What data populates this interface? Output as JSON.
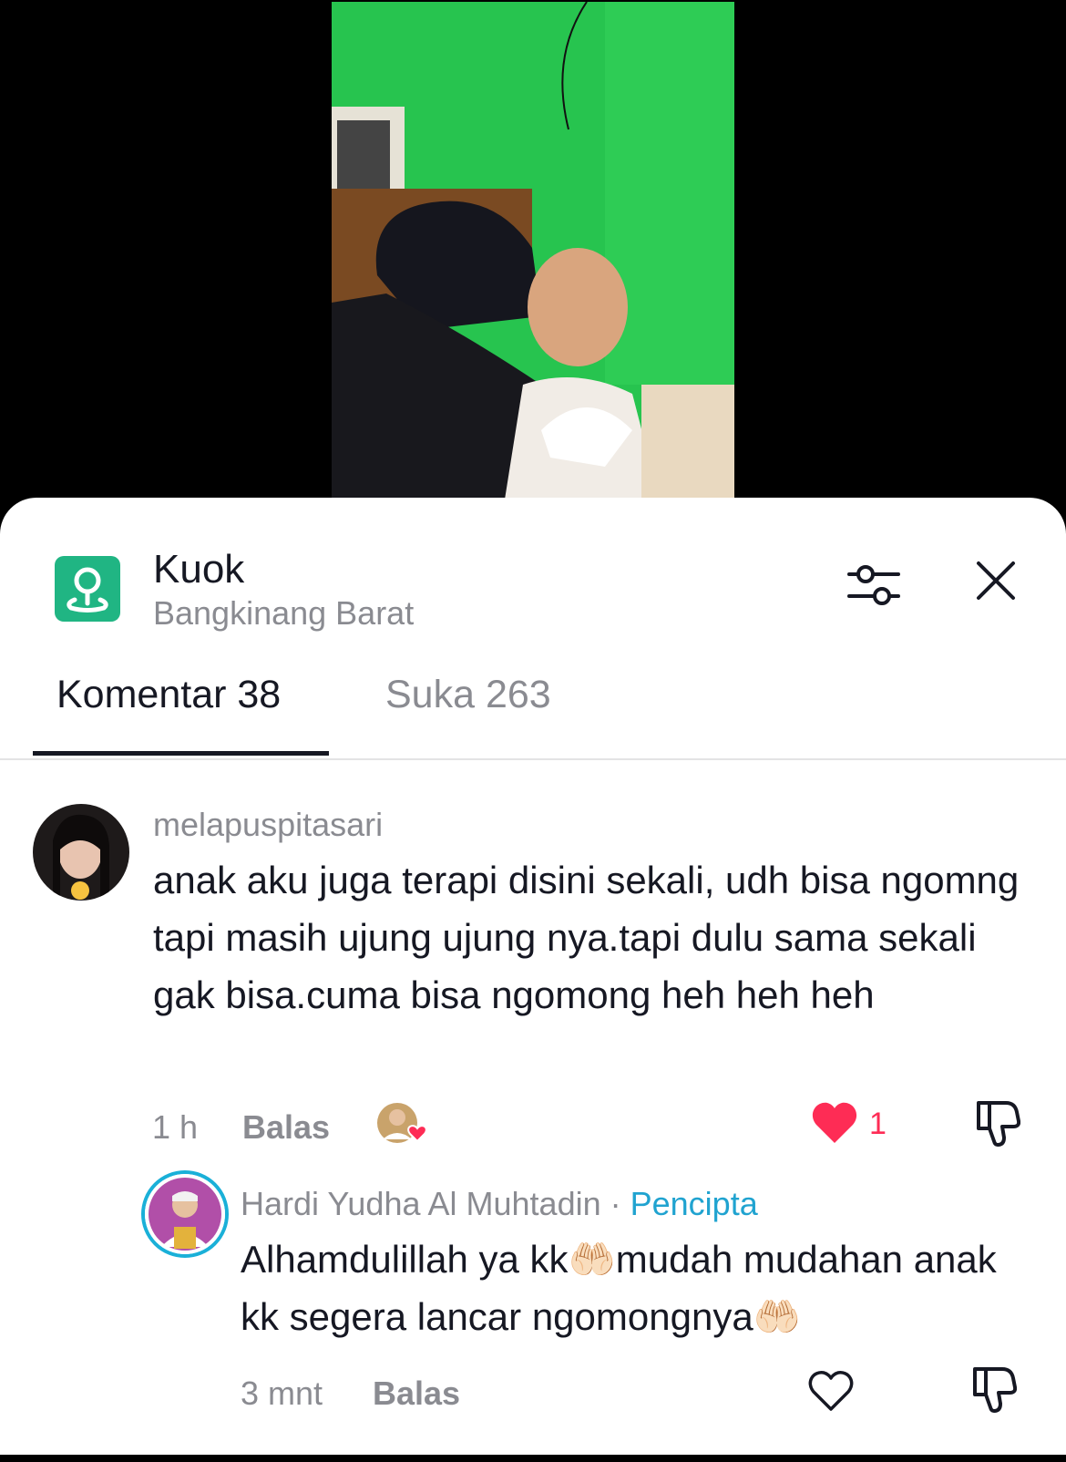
{
  "location": {
    "title": "Kuok",
    "subtitle": "Bangkinang Barat",
    "icon": "location-pin-icon"
  },
  "tabs": [
    {
      "label": "Komentar 38",
      "active": true
    },
    {
      "label": "Suka 263",
      "active": false
    }
  ],
  "comments": [
    {
      "username": "melapuspitasari",
      "text": "anak aku juga terapi disini sekali, udh bisa ngomng tapi masih ujung ujung nya.tapi dulu sama sekali gak bisa.cuma bisa ngomong heh heh heh",
      "time": "1 h",
      "reply_label": "Balas",
      "likes": "1",
      "liked": true
    },
    {
      "username": "Hardi Yudha Al Muhtadin",
      "separator": " · ",
      "badge": "Pencipta",
      "text": "Alhamdulillah ya kk🤲🏻mudah mudahan anak kk segera lancar ngomongnya🤲🏻",
      "time": "3 mnt",
      "reply_label": "Balas",
      "liked": false
    }
  ],
  "colors": {
    "accent_green": "#20b583",
    "like_red": "#fe2c55",
    "creator_blue": "#20a3d0",
    "text_dark": "#161823",
    "text_gray": "#8a8b91"
  }
}
